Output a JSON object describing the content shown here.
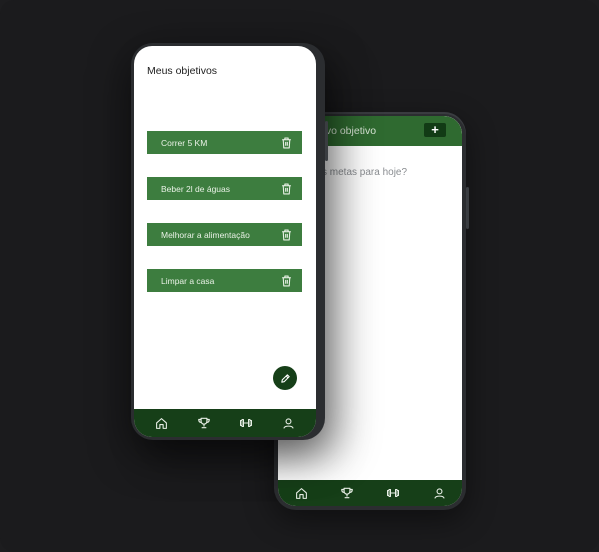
{
  "back_screen": {
    "header_title": "ovo objetivo",
    "add_label": "+",
    "question": "s metas para hoje?",
    "nav": [
      "home-icon",
      "trophy-icon",
      "dumbbell-icon",
      "user-icon"
    ]
  },
  "front_screen": {
    "title": "Meus objetivos",
    "goals": [
      {
        "label": "Correr 5 KM"
      },
      {
        "label": "Beber 2l de águas"
      },
      {
        "label": "Melhorar a alimentação"
      },
      {
        "label": "Limpar a casa"
      }
    ],
    "fab_icon": "pencil-icon",
    "nav": [
      "home-icon",
      "trophy-icon",
      "dumbbell-icon",
      "user-icon"
    ]
  },
  "colors": {
    "background": "#1b1b1d",
    "goal_green": "#3d7d3f",
    "nav_green": "#163f18",
    "header_green": "#2f6a30"
  }
}
